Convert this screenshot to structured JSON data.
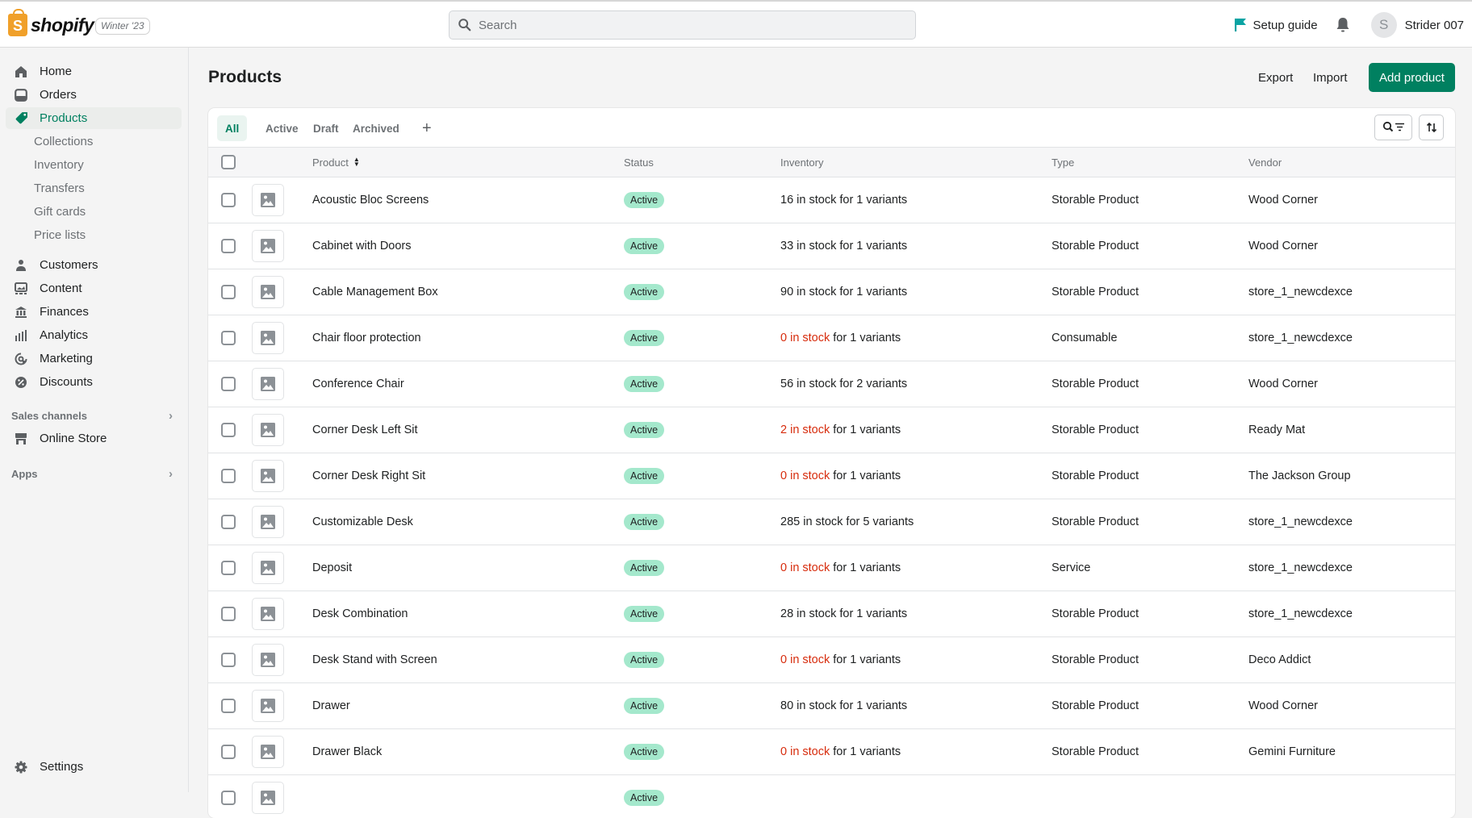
{
  "topbar": {
    "logo_text": "shopify",
    "edition": "Winter '23",
    "search_placeholder": "Search",
    "setup_guide": "Setup guide",
    "avatar_initial": "S",
    "user_name": "Strider 007",
    "accent": "#008060",
    "flag_color": "#0aa3a3"
  },
  "sidebar": {
    "items": [
      {
        "label": "Home",
        "icon": "home-icon"
      },
      {
        "label": "Orders",
        "icon": "orders-icon"
      },
      {
        "label": "Products",
        "icon": "tag-icon",
        "active": true
      },
      {
        "label": "Collections",
        "sub": true
      },
      {
        "label": "Inventory",
        "sub": true
      },
      {
        "label": "Transfers",
        "sub": true
      },
      {
        "label": "Gift cards",
        "sub": true
      },
      {
        "label": "Price lists",
        "sub": true
      },
      {
        "label": "Customers",
        "icon": "person-icon"
      },
      {
        "label": "Content",
        "icon": "content-icon"
      },
      {
        "label": "Finances",
        "icon": "bank-icon"
      },
      {
        "label": "Analytics",
        "icon": "bar-chart-icon"
      },
      {
        "label": "Marketing",
        "icon": "target-icon"
      },
      {
        "label": "Discounts",
        "icon": "discount-icon"
      }
    ],
    "sales_channels": "Sales channels",
    "online_store": "Online Store",
    "apps": "Apps",
    "settings": "Settings"
  },
  "page": {
    "title": "Products",
    "export": "Export",
    "import": "Import",
    "add_product": "Add product"
  },
  "tabs": [
    "All",
    "Active",
    "Draft",
    "Archived"
  ],
  "table": {
    "columns": [
      "Product",
      "Status",
      "Inventory",
      "Type",
      "Vendor"
    ],
    "rows": [
      {
        "product": "Acoustic Bloc Screens",
        "status": "Active",
        "stock": "16 in stock",
        "variants": " for 1 variants",
        "low": false,
        "type": "Storable Product",
        "vendor": "Wood Corner"
      },
      {
        "product": "Cabinet with Doors",
        "status": "Active",
        "stock": "33 in stock",
        "variants": " for 1 variants",
        "low": false,
        "type": "Storable Product",
        "vendor": "Wood Corner"
      },
      {
        "product": "Cable Management Box",
        "status": "Active",
        "stock": "90 in stock",
        "variants": " for 1 variants",
        "low": false,
        "type": "Storable Product",
        "vendor": "store_1_newcdexce"
      },
      {
        "product": "Chair floor protection",
        "status": "Active",
        "stock": "0 in stock",
        "variants": " for 1 variants",
        "low": true,
        "type": "Consumable",
        "vendor": "store_1_newcdexce"
      },
      {
        "product": "Conference Chair",
        "status": "Active",
        "stock": "56 in stock",
        "variants": " for 2 variants",
        "low": false,
        "type": "Storable Product",
        "vendor": "Wood Corner"
      },
      {
        "product": "Corner Desk Left Sit",
        "status": "Active",
        "stock": "2 in stock",
        "variants": " for 1 variants",
        "low": true,
        "type": "Storable Product",
        "vendor": "Ready Mat"
      },
      {
        "product": "Corner Desk Right Sit",
        "status": "Active",
        "stock": "0 in stock",
        "variants": " for 1 variants",
        "low": true,
        "type": "Storable Product",
        "vendor": "The Jackson Group"
      },
      {
        "product": "Customizable Desk",
        "status": "Active",
        "stock": "285 in stock",
        "variants": " for 5 variants",
        "low": false,
        "type": "Storable Product",
        "vendor": "store_1_newcdexce"
      },
      {
        "product": "Deposit",
        "status": "Active",
        "stock": "0 in stock",
        "variants": " for 1 variants",
        "low": true,
        "type": "Service",
        "vendor": "store_1_newcdexce"
      },
      {
        "product": "Desk Combination",
        "status": "Active",
        "stock": "28 in stock",
        "variants": " for 1 variants",
        "low": false,
        "type": "Storable Product",
        "vendor": "store_1_newcdexce"
      },
      {
        "product": "Desk Stand with Screen",
        "status": "Active",
        "stock": "0 in stock",
        "variants": " for 1 variants",
        "low": true,
        "type": "Storable Product",
        "vendor": "Deco Addict"
      },
      {
        "product": "Drawer",
        "status": "Active",
        "stock": "80 in stock",
        "variants": " for 1 variants",
        "low": false,
        "type": "Storable Product",
        "vendor": "Wood Corner"
      },
      {
        "product": "Drawer Black",
        "status": "Active",
        "stock": "0 in stock",
        "variants": " for 1 variants",
        "low": true,
        "type": "Storable Product",
        "vendor": "Gemini Furniture"
      },
      {
        "product": "",
        "status": "Active",
        "stock": "",
        "variants": "",
        "low": false,
        "type": "",
        "vendor": ""
      }
    ]
  }
}
